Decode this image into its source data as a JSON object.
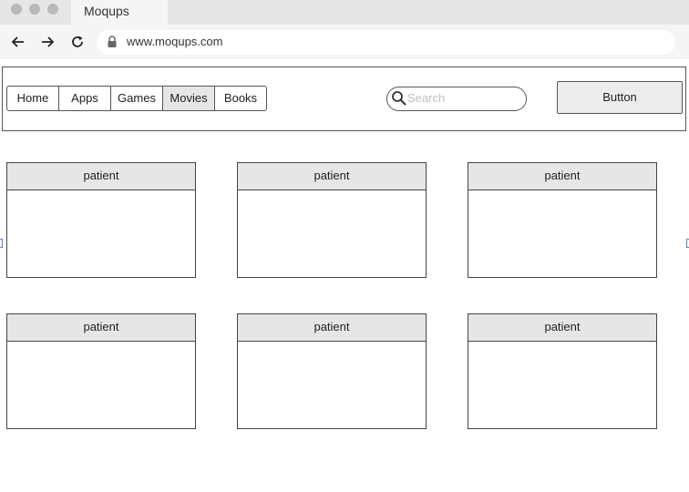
{
  "browser": {
    "tab_title": "Moqups",
    "url": "www.moqups.com",
    "icons": [
      "back-arrow-icon",
      "forward-arrow-icon",
      "reload-icon",
      "lock-icon"
    ]
  },
  "navbar": {
    "tabs": [
      {
        "label": "Home",
        "active": false
      },
      {
        "label": "Apps",
        "active": false
      },
      {
        "label": "Games",
        "active": false
      },
      {
        "label": "Movies",
        "active": true
      },
      {
        "label": "Books",
        "active": false
      }
    ],
    "search": {
      "placeholder": "Search"
    },
    "button_label": "Button"
  },
  "cards": [
    {
      "title": "patient"
    },
    {
      "title": "patient"
    },
    {
      "title": "patient"
    },
    {
      "title": "patient"
    },
    {
      "title": "patient"
    },
    {
      "title": "patient"
    }
  ],
  "colors": {
    "chrome_bg": "#e6e6e6",
    "active_tab": "#e6e6e6",
    "card_header": "#e6e6e6",
    "border": "#555555"
  }
}
